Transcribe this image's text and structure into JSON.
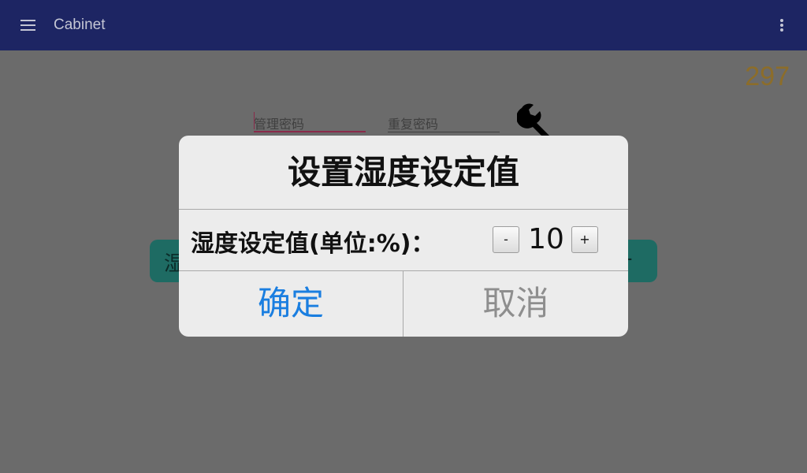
{
  "app_bar": {
    "title": "Cabinet",
    "menu_icon": "menu-icon",
    "overflow_icon": "overflow-icon",
    "color": "#1d2563"
  },
  "counter": "297",
  "password_fields": {
    "admin_placeholder": "管理密码",
    "repeat_placeholder": "重复密码"
  },
  "tool_icon": "wrench-icon",
  "background_button": {
    "label": "湿",
    "trailing": "+",
    "color": "#1e6b63"
  },
  "dialog": {
    "title": "设置湿度设定值",
    "setting_label": "湿度设定值(单位:%)：",
    "value": "10",
    "minus_label": "-",
    "plus_label": "+",
    "confirm_label": "确定",
    "cancel_label": "取消",
    "confirm_color": "#1a7ee0"
  }
}
